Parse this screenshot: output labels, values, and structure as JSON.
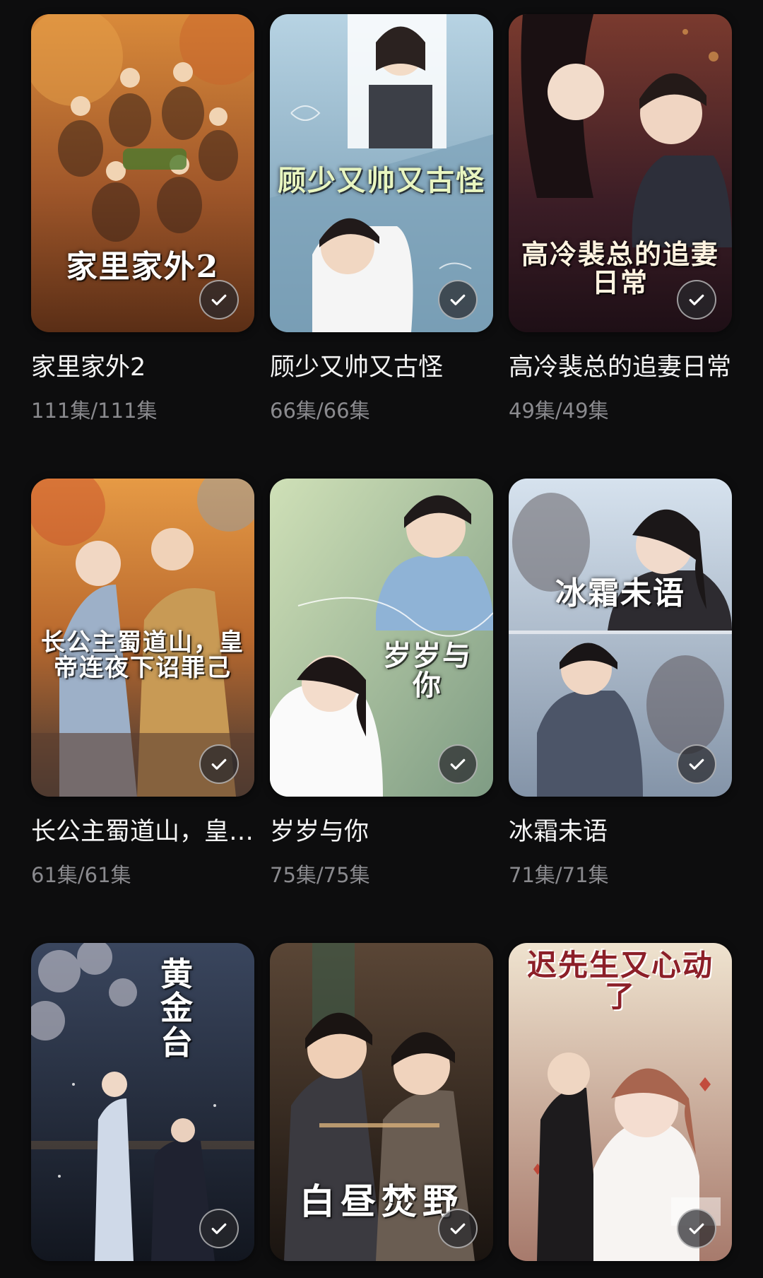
{
  "dramas": [
    {
      "title": "家里家外2",
      "episodes": "111集/111集",
      "poster_text": "家里家外2",
      "poster_colors": [
        "#c9782e",
        "#6b3a1a"
      ]
    },
    {
      "title": "顾少又帅又古怪",
      "episodes": "66集/66集",
      "poster_text": "顾少又帅又古怪",
      "poster_colors": [
        "#a9c8da",
        "#5f86a0"
      ]
    },
    {
      "title": "高冷裴总的追妻日常",
      "episodes": "49集/49集",
      "poster_text": "高冷裴总的追妻日常",
      "poster_colors": [
        "#5a2a3a",
        "#2a1420"
      ]
    },
    {
      "title": "长公主蜀道山，皇帝连夜下诏罪己",
      "episodes": "61集/61集",
      "poster_text": "长公主蜀道山，皇帝连夜下诏罪己",
      "poster_colors": [
        "#d9893a",
        "#5c3b2a"
      ]
    },
    {
      "title": "岁岁与你",
      "episodes": "75集/75集",
      "poster_text": "岁岁与你",
      "poster_colors": [
        "#b9cfa3",
        "#7e9a7a"
      ]
    },
    {
      "title": "冰霜未语",
      "episodes": "71集/71集",
      "poster_text": "冰霜未语",
      "poster_colors": [
        "#c7d3e0",
        "#6f7f93"
      ]
    },
    {
      "title": "",
      "episodes": "",
      "poster_text": "黄金台",
      "poster_colors": [
        "#2a3448",
        "#11161f"
      ]
    },
    {
      "title": "",
      "episodes": "",
      "poster_text": "白昼焚野",
      "poster_colors": [
        "#4a3a2e",
        "#1c1612"
      ]
    },
    {
      "title": "",
      "episodes": "",
      "poster_text": "迟先生又心动了",
      "poster_colors": [
        "#e9dcc6",
        "#9a6e62"
      ]
    }
  ]
}
